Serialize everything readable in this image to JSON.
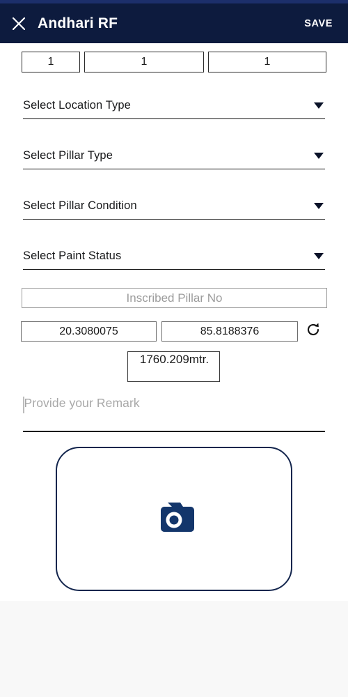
{
  "header": {
    "close_icon": "close-icon",
    "title": "Andhari RF",
    "save_label": "SAVE",
    "bar_color": "#0d1b3e",
    "status_color": "#1c2f6b"
  },
  "counts": [
    {
      "name": "count-field-1",
      "value": "1"
    },
    {
      "name": "count-field-2",
      "value": "1"
    },
    {
      "name": "count-field-3",
      "value": "1"
    }
  ],
  "selects": [
    {
      "label": "Select Location Type",
      "icon": "chevron-down-icon"
    },
    {
      "label": "Select Pillar Type",
      "icon": "chevron-down-icon"
    },
    {
      "label": "Select Pillar Condition",
      "icon": "chevron-down-icon"
    },
    {
      "label": "Select Paint Status",
      "icon": "chevron-down-icon"
    }
  ],
  "pillar_no": {
    "placeholder": "Inscribed Pillar No",
    "value": ""
  },
  "location": {
    "latitude": "20.3080075",
    "longitude": "85.8188376",
    "altitude": "1760.209mtr.",
    "refresh_icon": "refresh-icon"
  },
  "remark": {
    "placeholder": "Provide your Remark",
    "value": ""
  },
  "camera": {
    "icon": "camera-icon",
    "accent": "#13254d"
  }
}
